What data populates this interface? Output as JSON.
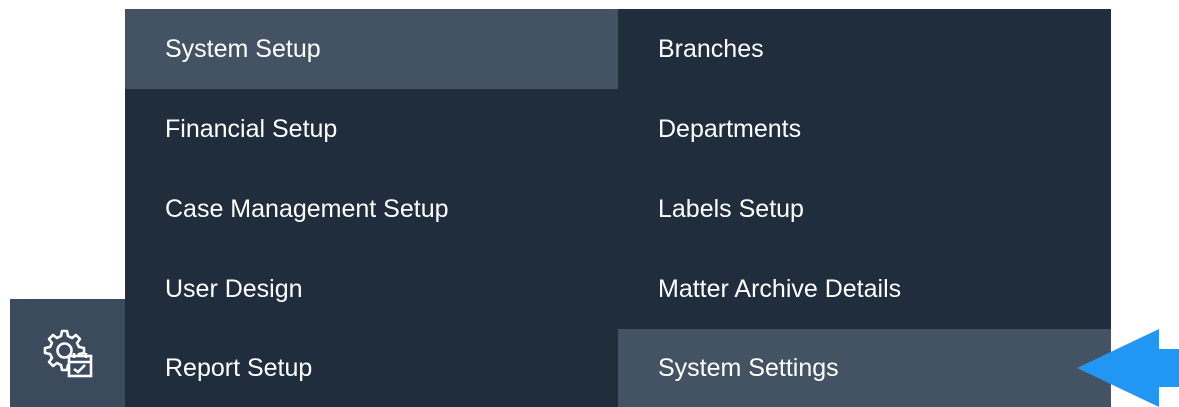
{
  "menu": {
    "left_items": [
      {
        "label": "System Setup",
        "active": true
      },
      {
        "label": "Financial Setup",
        "active": false
      },
      {
        "label": "Case Management Setup",
        "active": false
      },
      {
        "label": "User Design",
        "active": false
      },
      {
        "label": "Report Setup",
        "active": false
      }
    ],
    "right_items": [
      {
        "label": "Branches",
        "active": false
      },
      {
        "label": "Departments",
        "active": false
      },
      {
        "label": "Labels Setup",
        "active": false
      },
      {
        "label": "Matter Archive Details",
        "active": false
      },
      {
        "label": "System Settings",
        "active": true
      }
    ]
  },
  "sidebar": {
    "settings_icon": "settings-gear-with-calendar-icon"
  },
  "pointer": {
    "icon": "left-arrow-icon",
    "color": "#2196f3"
  },
  "colors": {
    "menu_background": "#1f2d3d",
    "active_item_background": "#445364",
    "sidebar_background": "#3b4a5c",
    "text": "#ffffff"
  }
}
